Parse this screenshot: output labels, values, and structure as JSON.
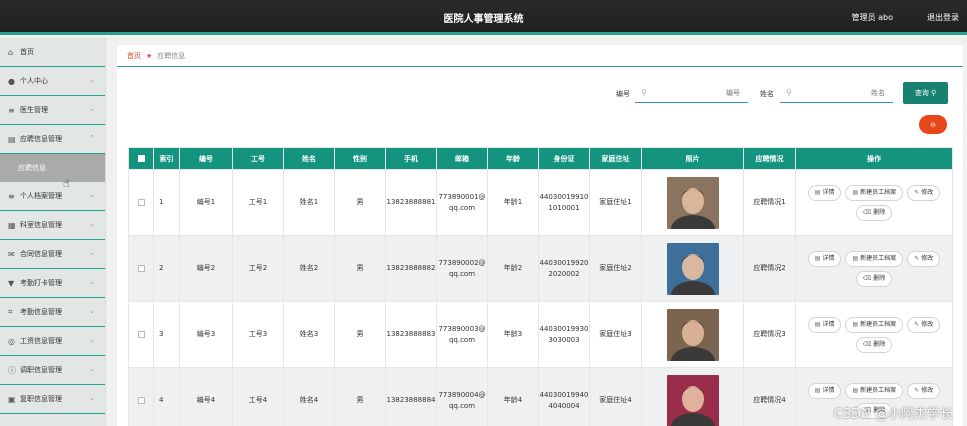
{
  "header": {
    "title": "医院人事管理系统",
    "admin": "管理员 abo",
    "logout": "退出登录"
  },
  "sidebar": {
    "items": [
      {
        "icon": "home-icon",
        "glyph": "⌂",
        "label": "首页",
        "chevron": ""
      },
      {
        "icon": "user-icon",
        "glyph": "●",
        "label": "个人中心",
        "chevron": "⌄"
      },
      {
        "icon": "list-icon",
        "glyph": "≡",
        "label": "医生管理",
        "chevron": "⌄"
      },
      {
        "icon": "monitor-icon",
        "glyph": "▤",
        "label": "应聘信息管理",
        "chevron": "⌃"
      },
      {
        "icon": "list-icon",
        "glyph": "≡",
        "label": "个人档案管理",
        "chevron": "⌄"
      },
      {
        "icon": "document-icon",
        "glyph": "▦",
        "label": "科室信息管理",
        "chevron": "⌄"
      },
      {
        "icon": "mail-icon",
        "glyph": "✉",
        "label": "合同信息管理",
        "chevron": "⌄"
      },
      {
        "icon": "filter-icon",
        "glyph": "▼",
        "label": "考勤打卡管理",
        "chevron": "⌄"
      },
      {
        "icon": "crop-icon",
        "glyph": "⌗",
        "label": "考勤信息管理",
        "chevron": "⌄"
      },
      {
        "icon": "globe-icon",
        "glyph": "◎",
        "label": "工资信息管理",
        "chevron": "⌄"
      },
      {
        "icon": "info-icon",
        "glyph": "ⓘ",
        "label": "调职信息管理",
        "chevron": "⌄"
      },
      {
        "icon": "folder-icon",
        "glyph": "▣",
        "label": "复职信息管理",
        "chevron": "⌄"
      }
    ],
    "sub_item": "应聘信息"
  },
  "breadcrumb": {
    "home": "首页",
    "current": "应聘信息"
  },
  "search": {
    "label_no": "编号",
    "placeholder_no": "编号",
    "label_name": "姓名",
    "placeholder_name": "姓名",
    "button": "查询"
  },
  "delete_all": "⊝",
  "table": {
    "headers": [
      "索引",
      "编号",
      "工号",
      "姓名",
      "性别",
      "手机",
      "邮箱",
      "年龄",
      "身份证",
      "家庭住址",
      "照片",
      "应聘情况",
      "操作"
    ],
    "ops": {
      "detail": "详情",
      "archive": "新建员工档案",
      "edit": "修改",
      "delete": "删除"
    },
    "rows": [
      {
        "index": "1",
        "no": "编号1",
        "job_no": "工号1",
        "name": "姓名1",
        "gender": "男",
        "phone": "13823888881",
        "email": "773890001@qq.com",
        "age": "年龄1",
        "id_card": "440300199101010001",
        "address": "家庭住址1",
        "status": "应聘情况1",
        "photo_bg": "#8a7460",
        "photo_fg": "#d9b59a"
      },
      {
        "index": "2",
        "no": "编号2",
        "job_no": "工号2",
        "name": "姓名2",
        "gender": "男",
        "phone": "13823888882",
        "email": "773890002@qq.com",
        "age": "年龄2",
        "id_card": "440300199202020002",
        "address": "家庭住址2",
        "status": "应聘情况2",
        "photo_bg": "#3d6f9a",
        "photo_fg": "#d8b8a0"
      },
      {
        "index": "3",
        "no": "编号3",
        "job_no": "工号3",
        "name": "姓名3",
        "gender": "男",
        "phone": "13823888883",
        "email": "773890003@qq.com",
        "age": "年龄3",
        "id_card": "440300199303030003",
        "address": "家庭住址3",
        "status": "应聘情况3",
        "photo_bg": "#7b6450",
        "photo_fg": "#d7b096"
      },
      {
        "index": "4",
        "no": "编号4",
        "job_no": "工号4",
        "name": "姓名4",
        "gender": "男",
        "phone": "13823888884",
        "email": "773890004@qq.com",
        "age": "年龄4",
        "id_card": "440300199404040004",
        "address": "家庭住址4",
        "status": "应聘情况4",
        "photo_bg": "#9a2d4a",
        "photo_fg": "#e0b29c"
      }
    ]
  },
  "watermark": "CSDN @小阿杰学长"
}
